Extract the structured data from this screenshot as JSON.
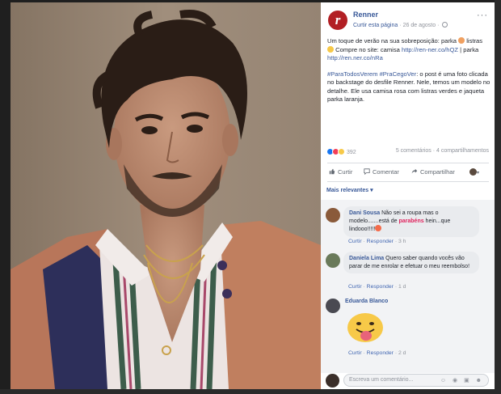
{
  "post": {
    "page_name": "Renner",
    "avatar_letter": "r",
    "follow_label": "Curtir esta página",
    "date": "26 de agosto",
    "more": "···",
    "text_p1_a": "Um toque de verão na sua sobreposição: parka ",
    "text_p1_b": " listras ",
    "text_p1_c": " Compre no site: camisa ",
    "text_p1_link1": "http://ren-ner.co/hQZ",
    "text_p1_d": " | parka ",
    "text_p1_link2": "http://ren.ner.co/nRa",
    "hashtags": "#ParaTodosVerem #PraCegoVer",
    "text_p2": ": o post é uma foto clicada no backstage do desfile Renner. Nele, temos um modelo no detalhe. Ele usa camisa rosa com listras verdes e jaqueta parka laranja.",
    "reaction_count": "392",
    "comments_count": "5 comentários",
    "shares_count": "4 compartilhamentos",
    "like_label": "Curtir",
    "comment_label": "Comentar",
    "share_label": "Compartilhar",
    "relevant_label": "Mais relevantes ▾"
  },
  "comments": [
    {
      "author": "Dani Sousa",
      "text_a": " Não sei a roupa mas o modelo.......está de ",
      "highlight": "parabéns",
      "text_b": " hein...que lindooo!!!!!",
      "like": "Curtir",
      "reply": "Responder",
      "time": "3 h"
    },
    {
      "author": "Daniela Lima",
      "text": " Quero saber quando vocês vão parar de me enrolar e efetuar o meu reembolso!",
      "like": "Curtir",
      "reply": "Responder",
      "time": "1 d"
    },
    {
      "author": "Eduarda Blanco",
      "like": "Curtir",
      "reply": "Responder",
      "time": "2 d"
    }
  ],
  "composer": {
    "placeholder": "Escreva um comentário...",
    "icons": "☺ ◉ ▣ ☻"
  },
  "colors": {
    "link": "#385898",
    "brand": "#b21f24",
    "highlight": "#e0245e"
  }
}
